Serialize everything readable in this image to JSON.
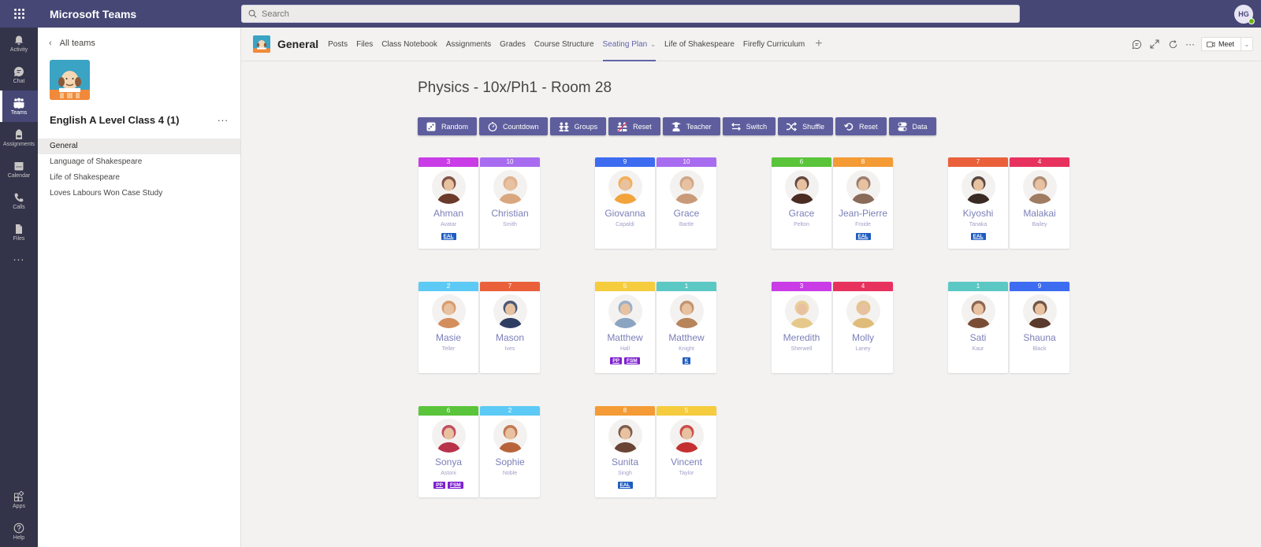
{
  "app": {
    "title": "Microsoft Teams",
    "search_placeholder": "Search",
    "user_initials": "HG"
  },
  "rail": {
    "items": [
      {
        "label": "Activity",
        "icon": "bell-icon"
      },
      {
        "label": "Chat",
        "icon": "chat-icon"
      },
      {
        "label": "Teams",
        "icon": "teams-icon",
        "active": true
      },
      {
        "label": "Assignments",
        "icon": "backpack-icon"
      },
      {
        "label": "Calendar",
        "icon": "calendar-icon"
      },
      {
        "label": "Calls",
        "icon": "phone-icon"
      },
      {
        "label": "Files",
        "icon": "file-icon"
      }
    ],
    "more": "...",
    "bottom": [
      {
        "label": "Apps",
        "icon": "apps-icon"
      },
      {
        "label": "Help",
        "icon": "help-icon"
      }
    ]
  },
  "team": {
    "back_label": "All teams",
    "name": "English A Level Class 4 (1)",
    "more": "...",
    "channels": [
      "General",
      "Language of Shakespeare",
      "Life of Shakespeare",
      "Loves Labours Won Case Study"
    ],
    "active_channel": "General"
  },
  "header": {
    "channel": "General",
    "tabs": [
      "Posts",
      "Files",
      "Class Notebook",
      "Assignments",
      "Grades",
      "Course Structure",
      "Seating Plan",
      "Life of Shakespeare",
      "Firefly Curriculum"
    ],
    "active_tab": "Seating Plan",
    "add_tab": "+",
    "more": "···",
    "meet_label": "Meet"
  },
  "plan": {
    "title": "Physics - 10x/Ph1 - Room 28",
    "buttons": [
      {
        "label": "Random",
        "icon": "dice-icon"
      },
      {
        "label": "Countdown",
        "icon": "stopwatch-icon"
      },
      {
        "label": "Groups",
        "icon": "groups-icon"
      },
      {
        "label": "Reset",
        "icon": "reset-groups-icon"
      },
      {
        "label": "Teacher",
        "icon": "teacher-icon"
      },
      {
        "label": "Switch",
        "icon": "switch-icon"
      },
      {
        "label": "Shuffle",
        "icon": "shuffle-icon"
      },
      {
        "label": "Reset",
        "icon": "undo-icon"
      },
      {
        "label": "Data",
        "icon": "toggle-icon"
      }
    ],
    "students": [
      {
        "first": "Ahman",
        "last": "Avatar",
        "group": "3",
        "color": "#c93ce6",
        "tags": [
          "EAL"
        ],
        "photo": "#6b3a2a"
      },
      {
        "first": "Christian",
        "last": "Smith",
        "group": "10",
        "color": "#a86cf0",
        "tags": [],
        "photo": "#d9a77f"
      },
      {
        "first": "Giovanna",
        "last": "Capaldi",
        "group": "9",
        "color": "#3d6cf0",
        "tags": [],
        "photo": "#f2a33b"
      },
      {
        "first": "Grace",
        "last": "Bartle",
        "group": "10",
        "color": "#a86cf0",
        "tags": [],
        "photo": "#c99a78"
      },
      {
        "first": "Grace",
        "last": "Pelton",
        "group": "6",
        "color": "#5ac43a",
        "tags": [],
        "photo": "#4a2c22"
      },
      {
        "first": "Jean-Pierre",
        "last": "Froide",
        "group": "8",
        "color": "#f49b35",
        "tags": [
          "EAL"
        ],
        "photo": "#8a6a58"
      },
      {
        "first": "Kiyoshi",
        "last": "Tanaka",
        "group": "7",
        "color": "#ea603a",
        "tags": [
          "EAL"
        ],
        "photo": "#3a2a24"
      },
      {
        "first": "Malakai",
        "last": "Bailey",
        "group": "4",
        "color": "#e8325e",
        "tags": [],
        "photo": "#a07c62"
      },
      {
        "first": "Masie",
        "last": "Teller",
        "group": "2",
        "color": "#5ccaf5",
        "tags": [],
        "photo": "#d48e5c"
      },
      {
        "first": "Mason",
        "last": "Ives",
        "group": "7",
        "color": "#ea603a",
        "tags": [],
        "photo": "#2e3e62"
      },
      {
        "first": "Matthew",
        "last": "Hall",
        "group": "5",
        "color": "#f5cc3d",
        "tags": [
          "PP",
          "FSM"
        ],
        "photo": "#8aa4c2"
      },
      {
        "first": "Matthew",
        "last": "Knight",
        "group": "1",
        "color": "#5cc8c4",
        "tags": [
          "K"
        ],
        "photo": "#b8845a"
      },
      {
        "first": "Meredith",
        "last": "Sherwell",
        "group": "3",
        "color": "#c93ce6",
        "tags": [],
        "photo": "#e6c98a"
      },
      {
        "first": "Molly",
        "last": "Laney",
        "group": "4",
        "color": "#e8325e",
        "tags": [],
        "photo": "#e0bc7a"
      },
      {
        "first": "Sati",
        "last": "Kaur",
        "group": "1",
        "color": "#5cc8c4",
        "tags": [],
        "photo": "#7a4e36"
      },
      {
        "first": "Shauna",
        "last": "Black",
        "group": "9",
        "color": "#3d6cf0",
        "tags": [],
        "photo": "#5a3a2c"
      },
      {
        "first": "Sonya",
        "last": "Astoni",
        "group": "6",
        "color": "#5ac43a",
        "tags": [
          "PP",
          "FSM"
        ],
        "photo": "#b8324a"
      },
      {
        "first": "Sophie",
        "last": "Noble",
        "group": "2",
        "color": "#5ccaf5",
        "tags": [],
        "photo": "#b8643a"
      },
      {
        "first": "Sunita",
        "last": "Singh",
        "group": "8",
        "color": "#f49b35",
        "tags": [
          "EAL"
        ],
        "photo": "#6a4434"
      },
      {
        "first": "Vincent",
        "last": "Taylor",
        "group": "5",
        "color": "#f5cc3d",
        "tags": [],
        "photo": "#c43030"
      }
    ]
  }
}
